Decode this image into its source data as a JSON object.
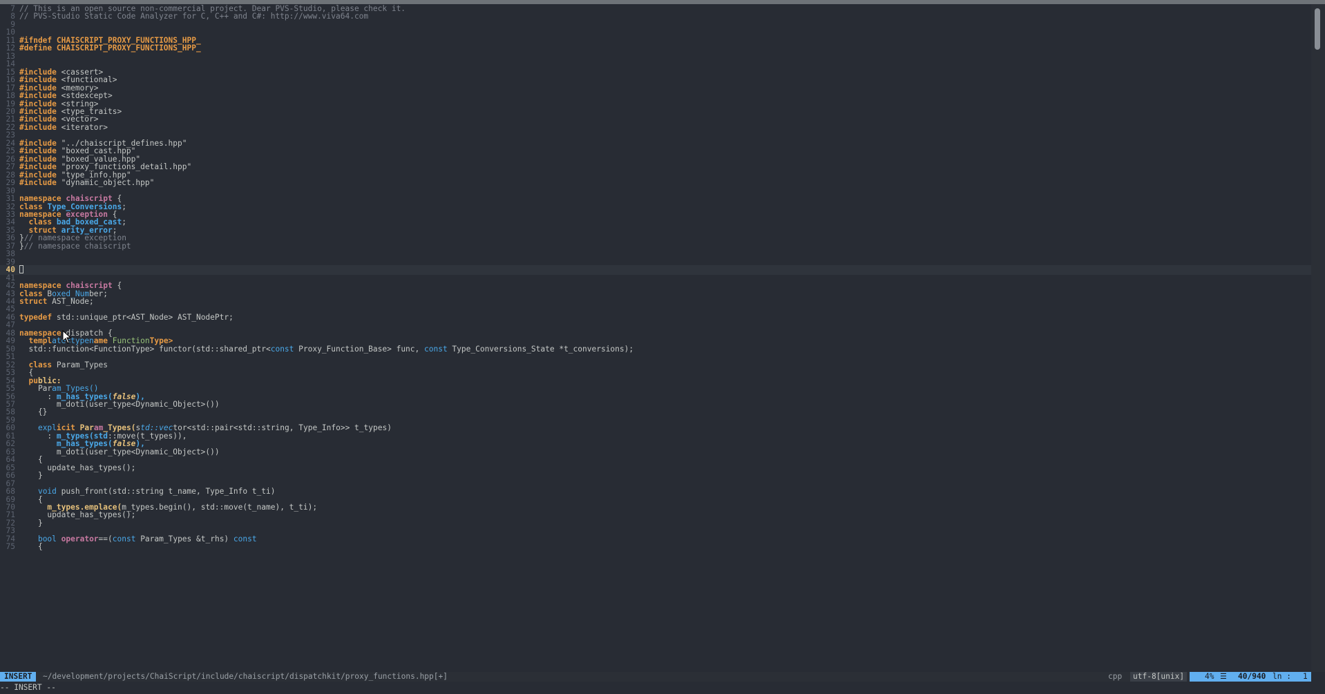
{
  "editor": {
    "cursor_line": 40,
    "lines": [
      {
        "n": "7",
        "t": [
          [
            "c",
            "// This is an open source non-commercial project. Dear PVS-Studio, please check it."
          ]
        ]
      },
      {
        "n": "8",
        "t": [
          [
            "c",
            "// PVS-Studio Static Code Analyzer for C, C++ and C#: http://www.viva64.com"
          ]
        ]
      },
      {
        "n": "9",
        "t": []
      },
      {
        "n": "10",
        "t": []
      },
      {
        "n": "11",
        "t": [
          [
            "p",
            "#ifndef CHAISCRIPT_PROXY_FUNCTIONS_HPP_"
          ]
        ]
      },
      {
        "n": "12",
        "t": [
          [
            "p",
            "#define CHAISCRIPT_PROXY_FUNCTIONS_HPP_"
          ]
        ]
      },
      {
        "n": "13",
        "t": []
      },
      {
        "n": "14",
        "t": []
      },
      {
        "n": "15",
        "t": [
          [
            "p",
            "#include"
          ],
          [
            "s",
            " <cassert>"
          ]
        ]
      },
      {
        "n": "16",
        "t": [
          [
            "p",
            "#include"
          ],
          [
            "s",
            " <functional>"
          ]
        ]
      },
      {
        "n": "17",
        "t": [
          [
            "p",
            "#include"
          ],
          [
            "s",
            " <memory>"
          ]
        ]
      },
      {
        "n": "18",
        "t": [
          [
            "p",
            "#include"
          ],
          [
            "s",
            " <stdexcept>"
          ]
        ]
      },
      {
        "n": "19",
        "t": [
          [
            "p",
            "#include"
          ],
          [
            "s",
            " <string>"
          ]
        ]
      },
      {
        "n": "20",
        "t": [
          [
            "p",
            "#include"
          ],
          [
            "s",
            " <type_traits>"
          ]
        ]
      },
      {
        "n": "21",
        "t": [
          [
            "p",
            "#include"
          ],
          [
            "s",
            " <vector>"
          ]
        ]
      },
      {
        "n": "22",
        "t": [
          [
            "p",
            "#include"
          ],
          [
            "s",
            " <iterator>"
          ]
        ]
      },
      {
        "n": "23",
        "t": []
      },
      {
        "n": "24",
        "t": [
          [
            "p",
            "#include"
          ],
          [
            "s",
            " \"../chaiscript_defines.hpp\""
          ]
        ]
      },
      {
        "n": "25",
        "t": [
          [
            "p",
            "#include"
          ],
          [
            "s",
            " \"boxed_cast.hpp\""
          ]
        ]
      },
      {
        "n": "26",
        "t": [
          [
            "p",
            "#include"
          ],
          [
            "s",
            " \"boxed_value.hpp\""
          ]
        ]
      },
      {
        "n": "27",
        "t": [
          [
            "p",
            "#include"
          ],
          [
            "s",
            " \"proxy_functions_detail.hpp\""
          ]
        ]
      },
      {
        "n": "28",
        "t": [
          [
            "p",
            "#include"
          ],
          [
            "s",
            " \"type_info.hpp\""
          ]
        ]
      },
      {
        "n": "29",
        "t": [
          [
            "p",
            "#include"
          ],
          [
            "s",
            " \"dynamic_object.hpp\""
          ]
        ]
      },
      {
        "n": "30",
        "t": []
      },
      {
        "n": "31",
        "t": [
          [
            "k",
            "namespace"
          ],
          [
            "s",
            " "
          ],
          [
            "ns",
            "chaiscript"
          ],
          [
            "s",
            " {"
          ]
        ]
      },
      {
        "n": "32",
        "t": [
          [
            "k",
            "class"
          ],
          [
            "s",
            " "
          ],
          [
            "ty",
            "Type_Conversions"
          ],
          [
            "s",
            ";"
          ]
        ]
      },
      {
        "n": "33",
        "t": [
          [
            "k",
            "namespace"
          ],
          [
            "s",
            " "
          ],
          [
            "ns",
            "exception"
          ],
          [
            "s",
            " {"
          ]
        ]
      },
      {
        "n": "34",
        "t": [
          [
            "s",
            "  "
          ],
          [
            "k",
            "class"
          ],
          [
            "s",
            " "
          ],
          [
            "ty",
            "bad_boxed_cast"
          ],
          [
            "s",
            ";"
          ]
        ]
      },
      {
        "n": "35",
        "t": [
          [
            "s",
            "  "
          ],
          [
            "k",
            "struct"
          ],
          [
            "s",
            " "
          ],
          [
            "ty",
            "arity_error"
          ],
          [
            "s",
            ";"
          ]
        ]
      },
      {
        "n": "36",
        "t": [
          [
            "s",
            "}"
          ],
          [
            "c",
            "// namespace exception"
          ]
        ]
      },
      {
        "n": "37",
        "t": [
          [
            "s",
            "}"
          ],
          [
            "c",
            "// namespace chaiscript"
          ]
        ]
      },
      {
        "n": "38",
        "t": []
      },
      {
        "n": "39",
        "t": []
      },
      {
        "n": "40",
        "t": [],
        "cursor": true
      },
      {
        "n": "41",
        "t": []
      },
      {
        "n": "42",
        "t": [
          [
            "k",
            "namespace"
          ],
          [
            "s",
            " "
          ],
          [
            "ns",
            "chaiscript"
          ],
          [
            "s",
            " {"
          ]
        ]
      },
      {
        "n": "43",
        "t": [
          [
            "k",
            "class"
          ],
          [
            "s",
            " B"
          ],
          [
            "kw2",
            "oxed_Num"
          ],
          [
            "s",
            "ber;"
          ]
        ]
      },
      {
        "n": "44",
        "t": [
          [
            "k",
            "struct"
          ],
          [
            "s",
            " AST_Node;"
          ]
        ]
      },
      {
        "n": "45",
        "t": []
      },
      {
        "n": "46",
        "t": [
          [
            "k",
            "typedef"
          ],
          [
            "s",
            " std::unique_ptr<AST_Node> AST_NodePtr;"
          ]
        ]
      },
      {
        "n": "47",
        "t": []
      },
      {
        "n": "48",
        "t": [
          [
            "k",
            "namespace"
          ],
          [
            "s",
            " dispatch {"
          ]
        ]
      },
      {
        "n": "49",
        "t": [
          [
            "s",
            "  "
          ],
          [
            "k",
            "templ"
          ],
          [
            "kw2",
            "ate<typen"
          ],
          [
            "k",
            "ame "
          ],
          [
            "g",
            "Function"
          ],
          [
            "k",
            "Type>"
          ]
        ]
      },
      {
        "n": "50",
        "t": [
          [
            "s",
            "  std::function<FunctionType> functor(std::shared_ptr<"
          ],
          [
            "kw2",
            "const"
          ],
          [
            "s",
            " Proxy_Function_Base> func, "
          ],
          [
            "kw2",
            "const"
          ],
          [
            "s",
            " Type_Conversions_State *t_conversions);"
          ]
        ]
      },
      {
        "n": "51",
        "t": []
      },
      {
        "n": "52",
        "t": [
          [
            "s",
            "  "
          ],
          [
            "k",
            "class"
          ],
          [
            "s",
            " Param_Types"
          ]
        ]
      },
      {
        "n": "53",
        "t": [
          [
            "s",
            "  {"
          ]
        ]
      },
      {
        "n": "54",
        "t": [
          [
            "s",
            "  "
          ],
          [
            "k",
            "pu"
          ],
          [
            "f",
            "blic:"
          ]
        ]
      },
      {
        "n": "55",
        "t": [
          [
            "s",
            "    Par"
          ],
          [
            "kw2",
            "am_Types()"
          ]
        ]
      },
      {
        "n": "56",
        "t": [
          [
            "s",
            "      : "
          ],
          [
            "ty",
            "m_has_types("
          ],
          [
            "cn",
            "false"
          ],
          [
            "ty",
            "),"
          ]
        ]
      },
      {
        "n": "57",
        "t": [
          [
            "s",
            "        m_doti(user_type<Dynamic_Object>())"
          ]
        ]
      },
      {
        "n": "58",
        "t": [
          [
            "s",
            "    {}"
          ]
        ]
      },
      {
        "n": "59",
        "t": []
      },
      {
        "n": "60",
        "t": [
          [
            "s",
            "    "
          ],
          [
            "kw2",
            "expl"
          ],
          [
            "k",
            "icit"
          ],
          [
            "s",
            " "
          ],
          [
            "f",
            "Par"
          ],
          [
            "ns",
            "am"
          ],
          [
            "f",
            "_Types("
          ],
          [
            "s",
            "s"
          ],
          [
            "it",
            "td::vec"
          ],
          [
            "s",
            "tor<std::pair<std::string, Type_Info>> t_types)"
          ]
        ]
      },
      {
        "n": "61",
        "t": [
          [
            "s",
            "      : "
          ],
          [
            "ty",
            "m_types(std"
          ],
          [
            "s",
            "::move(t_types)),"
          ]
        ]
      },
      {
        "n": "62",
        "t": [
          [
            "s",
            "        "
          ],
          [
            "ty",
            "m_has_types("
          ],
          [
            "cn",
            "false"
          ],
          [
            "ty",
            "),"
          ]
        ]
      },
      {
        "n": "63",
        "t": [
          [
            "s",
            "        m_doti(user_type<Dynamic_Object>())"
          ]
        ]
      },
      {
        "n": "64",
        "t": [
          [
            "s",
            "    {"
          ]
        ]
      },
      {
        "n": "65",
        "t": [
          [
            "s",
            "      update_has_types();"
          ]
        ]
      },
      {
        "n": "66",
        "t": [
          [
            "s",
            "    }"
          ]
        ]
      },
      {
        "n": "67",
        "t": []
      },
      {
        "n": "68",
        "t": [
          [
            "s",
            "    "
          ],
          [
            "kw2",
            "void"
          ],
          [
            "s",
            " push_front(std::string t_name, Type_Info t_ti)"
          ]
        ]
      },
      {
        "n": "69",
        "t": [
          [
            "s",
            "    {"
          ]
        ]
      },
      {
        "n": "70",
        "t": [
          [
            "s",
            "      "
          ],
          [
            "f",
            "m_types.emplace("
          ],
          [
            "s",
            "m_types.begin(), std::move(t_name), t_ti);"
          ]
        ]
      },
      {
        "n": "71",
        "t": [
          [
            "s",
            "      update_has_types();"
          ]
        ]
      },
      {
        "n": "72",
        "t": [
          [
            "s",
            "    }"
          ]
        ]
      },
      {
        "n": "73",
        "t": []
      },
      {
        "n": "74",
        "t": [
          [
            "s",
            "    "
          ],
          [
            "kw2",
            "bool"
          ],
          [
            "s",
            " "
          ],
          [
            "ns",
            "operator"
          ],
          [
            "s",
            "==("
          ],
          [
            "kw2",
            "const"
          ],
          [
            "s",
            " Param_Types &t_rhs) "
          ],
          [
            "kw2",
            "const"
          ]
        ]
      },
      {
        "n": "75",
        "t": [
          [
            "s",
            "    {"
          ]
        ]
      }
    ]
  },
  "statusline": {
    "mode": "INSERT",
    "path": "~/development/projects/ChaiScript/include/chaiscript/dispatchkit/proxy_functions.hpp[+]",
    "filetype": "cpp",
    "encoding": "utf-8[unix]",
    "percent": "4%",
    "percent_icon": "☰",
    "position": "40/940",
    "ln_label": "ln :",
    "column": "1"
  },
  "cmdline": {
    "text": "-- INSERT --"
  },
  "colors": {
    "background": "#282c34",
    "accent": "#61afef"
  }
}
